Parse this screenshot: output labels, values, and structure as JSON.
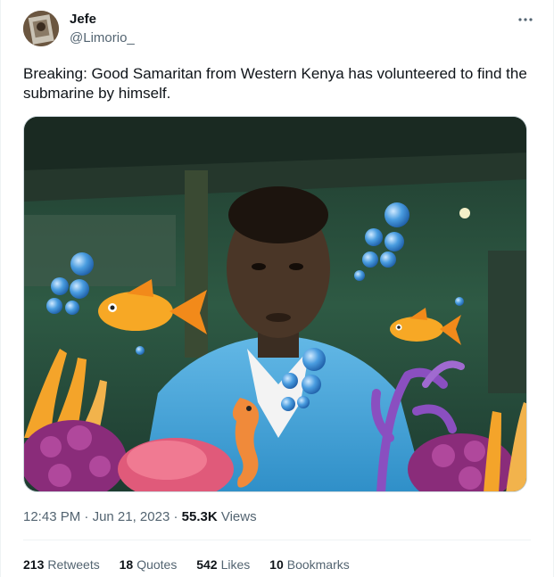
{
  "author": {
    "name": "Jefe",
    "handle": "@Limorio_"
  },
  "tweet": {
    "text": "Breaking: Good Samaritan from Western Kenya has volunteered to find the submarine by himself."
  },
  "meta": {
    "time": "12:43 PM",
    "separator": "·",
    "date": "Jun 21, 2023",
    "views_count": "55.3K",
    "views_label": "Views"
  },
  "stats": {
    "retweets": {
      "count": "213",
      "label": "Retweets"
    },
    "quotes": {
      "count": "18",
      "label": "Quotes"
    },
    "likes": {
      "count": "542",
      "label": "Likes"
    },
    "bookmarks": {
      "count": "10",
      "label": "Bookmarks"
    }
  },
  "icons": {
    "more": "more-horizontal-icon"
  },
  "colors": {
    "text_primary": "#0f1419",
    "text_secondary": "#536471",
    "border": "#eff3f4"
  }
}
